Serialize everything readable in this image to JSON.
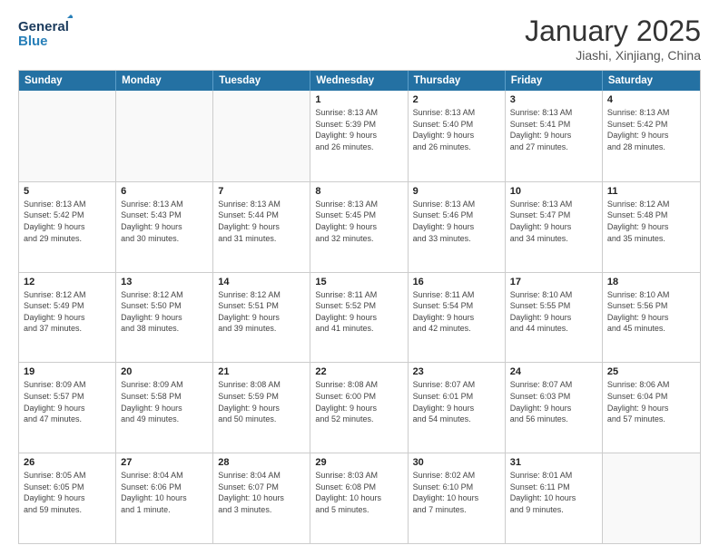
{
  "logo": {
    "line1": "General",
    "line2": "Blue"
  },
  "title": "January 2025",
  "subtitle": "Jiashi, Xinjiang, China",
  "days_of_week": [
    "Sunday",
    "Monday",
    "Tuesday",
    "Wednesday",
    "Thursday",
    "Friday",
    "Saturday"
  ],
  "weeks": [
    [
      {
        "day": "",
        "info": ""
      },
      {
        "day": "",
        "info": ""
      },
      {
        "day": "",
        "info": ""
      },
      {
        "day": "1",
        "info": "Sunrise: 8:13 AM\nSunset: 5:39 PM\nDaylight: 9 hours\nand 26 minutes."
      },
      {
        "day": "2",
        "info": "Sunrise: 8:13 AM\nSunset: 5:40 PM\nDaylight: 9 hours\nand 26 minutes."
      },
      {
        "day": "3",
        "info": "Sunrise: 8:13 AM\nSunset: 5:41 PM\nDaylight: 9 hours\nand 27 minutes."
      },
      {
        "day": "4",
        "info": "Sunrise: 8:13 AM\nSunset: 5:42 PM\nDaylight: 9 hours\nand 28 minutes."
      }
    ],
    [
      {
        "day": "5",
        "info": "Sunrise: 8:13 AM\nSunset: 5:42 PM\nDaylight: 9 hours\nand 29 minutes."
      },
      {
        "day": "6",
        "info": "Sunrise: 8:13 AM\nSunset: 5:43 PM\nDaylight: 9 hours\nand 30 minutes."
      },
      {
        "day": "7",
        "info": "Sunrise: 8:13 AM\nSunset: 5:44 PM\nDaylight: 9 hours\nand 31 minutes."
      },
      {
        "day": "8",
        "info": "Sunrise: 8:13 AM\nSunset: 5:45 PM\nDaylight: 9 hours\nand 32 minutes."
      },
      {
        "day": "9",
        "info": "Sunrise: 8:13 AM\nSunset: 5:46 PM\nDaylight: 9 hours\nand 33 minutes."
      },
      {
        "day": "10",
        "info": "Sunrise: 8:13 AM\nSunset: 5:47 PM\nDaylight: 9 hours\nand 34 minutes."
      },
      {
        "day": "11",
        "info": "Sunrise: 8:12 AM\nSunset: 5:48 PM\nDaylight: 9 hours\nand 35 minutes."
      }
    ],
    [
      {
        "day": "12",
        "info": "Sunrise: 8:12 AM\nSunset: 5:49 PM\nDaylight: 9 hours\nand 37 minutes."
      },
      {
        "day": "13",
        "info": "Sunrise: 8:12 AM\nSunset: 5:50 PM\nDaylight: 9 hours\nand 38 minutes."
      },
      {
        "day": "14",
        "info": "Sunrise: 8:12 AM\nSunset: 5:51 PM\nDaylight: 9 hours\nand 39 minutes."
      },
      {
        "day": "15",
        "info": "Sunrise: 8:11 AM\nSunset: 5:52 PM\nDaylight: 9 hours\nand 41 minutes."
      },
      {
        "day": "16",
        "info": "Sunrise: 8:11 AM\nSunset: 5:54 PM\nDaylight: 9 hours\nand 42 minutes."
      },
      {
        "day": "17",
        "info": "Sunrise: 8:10 AM\nSunset: 5:55 PM\nDaylight: 9 hours\nand 44 minutes."
      },
      {
        "day": "18",
        "info": "Sunrise: 8:10 AM\nSunset: 5:56 PM\nDaylight: 9 hours\nand 45 minutes."
      }
    ],
    [
      {
        "day": "19",
        "info": "Sunrise: 8:09 AM\nSunset: 5:57 PM\nDaylight: 9 hours\nand 47 minutes."
      },
      {
        "day": "20",
        "info": "Sunrise: 8:09 AM\nSunset: 5:58 PM\nDaylight: 9 hours\nand 49 minutes."
      },
      {
        "day": "21",
        "info": "Sunrise: 8:08 AM\nSunset: 5:59 PM\nDaylight: 9 hours\nand 50 minutes."
      },
      {
        "day": "22",
        "info": "Sunrise: 8:08 AM\nSunset: 6:00 PM\nDaylight: 9 hours\nand 52 minutes."
      },
      {
        "day": "23",
        "info": "Sunrise: 8:07 AM\nSunset: 6:01 PM\nDaylight: 9 hours\nand 54 minutes."
      },
      {
        "day": "24",
        "info": "Sunrise: 8:07 AM\nSunset: 6:03 PM\nDaylight: 9 hours\nand 56 minutes."
      },
      {
        "day": "25",
        "info": "Sunrise: 8:06 AM\nSunset: 6:04 PM\nDaylight: 9 hours\nand 57 minutes."
      }
    ],
    [
      {
        "day": "26",
        "info": "Sunrise: 8:05 AM\nSunset: 6:05 PM\nDaylight: 9 hours\nand 59 minutes."
      },
      {
        "day": "27",
        "info": "Sunrise: 8:04 AM\nSunset: 6:06 PM\nDaylight: 10 hours\nand 1 minute."
      },
      {
        "day": "28",
        "info": "Sunrise: 8:04 AM\nSunset: 6:07 PM\nDaylight: 10 hours\nand 3 minutes."
      },
      {
        "day": "29",
        "info": "Sunrise: 8:03 AM\nSunset: 6:08 PM\nDaylight: 10 hours\nand 5 minutes."
      },
      {
        "day": "30",
        "info": "Sunrise: 8:02 AM\nSunset: 6:10 PM\nDaylight: 10 hours\nand 7 minutes."
      },
      {
        "day": "31",
        "info": "Sunrise: 8:01 AM\nSunset: 6:11 PM\nDaylight: 10 hours\nand 9 minutes."
      },
      {
        "day": "",
        "info": ""
      }
    ]
  ]
}
